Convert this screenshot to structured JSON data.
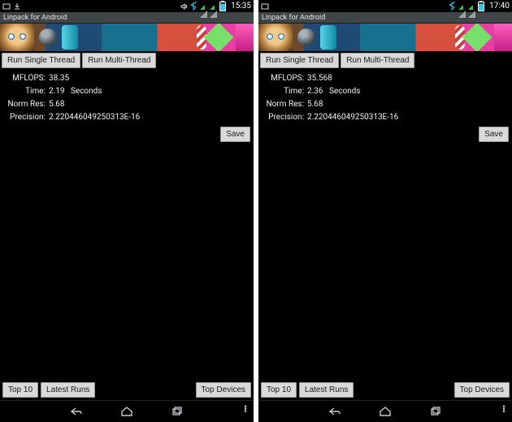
{
  "panes": [
    {
      "statusbar": {
        "time": "15:35"
      },
      "title": "Linpack for Android",
      "buttons": {
        "single": "Run Single Thread",
        "multi": "Run Multi-Thread"
      },
      "results": {
        "mflops_label": "MFLOPS:",
        "mflops_value": "38.35",
        "time_label": "Time:",
        "time_value": "2.19",
        "time_unit": "Seconds",
        "norm_label": "Norm Res:",
        "norm_value": "5.68",
        "precision_label": "Precision:",
        "precision_value": "2.220446049250313E-16"
      },
      "save_label": "Save",
      "bottom": {
        "top10": "Top 10",
        "latest": "Latest Runs",
        "topdev": "Top Devices"
      }
    },
    {
      "statusbar": {
        "time": "17:40"
      },
      "title": "Linpack for Android",
      "buttons": {
        "single": "Run Single Thread",
        "multi": "Run Multi-Thread"
      },
      "results": {
        "mflops_label": "MFLOPS:",
        "mflops_value": "35.568",
        "time_label": "Time:",
        "time_value": "2.36",
        "time_unit": "Seconds",
        "norm_label": "Norm Res:",
        "norm_value": "5.68",
        "precision_label": "Precision:",
        "precision_value": "2.220446049250313E-16"
      },
      "save_label": "Save",
      "bottom": {
        "top10": "Top 10",
        "latest": "Latest Runs",
        "topdev": "Top Devices"
      }
    }
  ]
}
